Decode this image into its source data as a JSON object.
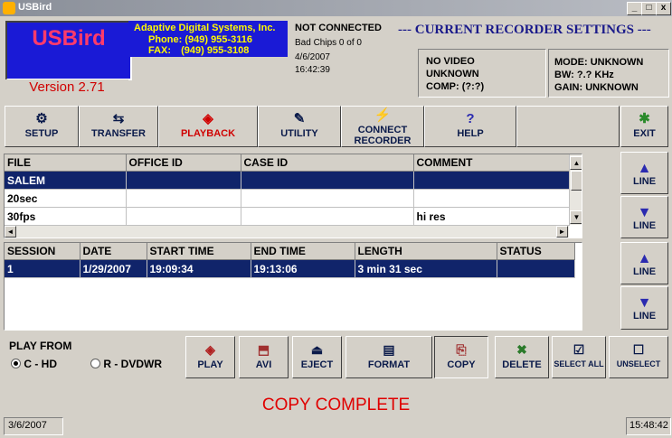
{
  "window": {
    "title": "USBird",
    "controls": {
      "minimize": "_",
      "maximize": "□",
      "close": "x"
    }
  },
  "branding": {
    "logo": "USBird",
    "company": "Adaptive Digital Systems, Inc.",
    "phone": "Phone: (949) 955-3116",
    "fax_label": "FAX:",
    "fax": "(949) 955-3108",
    "version": "Version 2.71"
  },
  "connection": {
    "status": "NOT CONNECTED",
    "bad_chips": "Bad Chips 0 of 0",
    "date": "4/6/2007",
    "time": "16:42:39"
  },
  "recorder_settings": {
    "header": "--- CURRENT RECORDER SETTINGS ---",
    "video": "NO VIDEO",
    "unknown": "UNKNOWN",
    "comp": "COMP: (?:?)",
    "mode": "MODE: UNKNOWN",
    "bw": "BW: ?.? KHz",
    "gain": "GAIN: UNKNOWN"
  },
  "toolbar": [
    {
      "label": "SETUP",
      "icon": "setup-icon",
      "glyph": "⚙"
    },
    {
      "label": "TRANSFER",
      "icon": "transfer-icon",
      "glyph": "⇆"
    },
    {
      "label": "PLAYBACK",
      "icon": "playback-icon",
      "glyph": "◈"
    },
    {
      "label": "UTILITY",
      "icon": "utility-icon",
      "glyph": "✎"
    },
    {
      "label": "CONNECT RECORDER",
      "icon": "connect-icon",
      "glyph": "⚡"
    },
    {
      "label": "HELP",
      "icon": "help-icon",
      "glyph": "?"
    },
    {
      "label": "EXIT",
      "icon": "exit-icon",
      "glyph": "✱"
    }
  ],
  "files_table": {
    "columns": [
      "FILE",
      "OFFICE ID",
      "CASE ID",
      "COMMENT"
    ],
    "rows": [
      {
        "file": "SALEM",
        "office_id": "",
        "case_id": "",
        "comment": "",
        "selected": true
      },
      {
        "file": "20sec",
        "office_id": "",
        "case_id": "",
        "comment": "",
        "selected": false
      },
      {
        "file": "30fps",
        "office_id": "",
        "case_id": "",
        "comment": "hi res",
        "selected": false
      }
    ]
  },
  "sessions_table": {
    "columns": [
      "SESSION",
      "DATE",
      "START TIME",
      "END TIME",
      "LENGTH",
      "STATUS"
    ],
    "rows": [
      {
        "session": "1",
        "date": "1/29/2007",
        "start": "19:09:34",
        "end": "19:13:06",
        "length": "3 min 31 sec",
        "status": "",
        "selected": true
      }
    ]
  },
  "line_buttons": [
    {
      "label": "LINE",
      "direction": "up"
    },
    {
      "label": "LINE",
      "direction": "down"
    },
    {
      "label": "LINE",
      "direction": "up"
    },
    {
      "label": "LINE",
      "direction": "down"
    }
  ],
  "play_from": {
    "label": "PLAY FROM",
    "options": [
      {
        "label": "C - HD",
        "selected": true
      },
      {
        "label": "R - DVDWR",
        "selected": false
      }
    ]
  },
  "bottom_buttons": [
    {
      "label": "PLAY",
      "icon": "play-icon",
      "glyph": "◈"
    },
    {
      "label": "AVI",
      "icon": "avi-icon",
      "glyph": "⬒"
    },
    {
      "label": "EJECT",
      "icon": "eject-icon",
      "glyph": "⏏"
    },
    {
      "label": "FORMAT",
      "icon": "format-icon",
      "glyph": "▤"
    },
    {
      "label": "COPY",
      "icon": "copy-icon",
      "glyph": "⎘"
    },
    {
      "label": "DELETE",
      "icon": "delete-icon",
      "glyph": "✖"
    },
    {
      "label": "SELECT ALL",
      "icon": "select-all-icon",
      "glyph": "☑"
    },
    {
      "label": "UNSELECT",
      "icon": "unselect-icon",
      "glyph": "☐"
    }
  ],
  "message": "COPY COMPLETE",
  "statusbar": {
    "date": "3/6/2007",
    "time": "15:48:42"
  },
  "colors": {
    "selection": "#10246a",
    "message": "#e00000",
    "logo_bg": "#1a1ad6",
    "playback_label": "#d00000"
  }
}
